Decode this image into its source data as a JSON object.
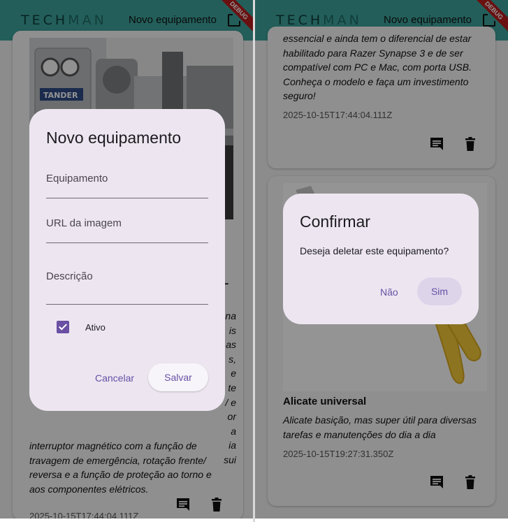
{
  "app": {
    "logo_part1": "TECH",
    "logo_part2": "MAN",
    "title": "Novo equipamento",
    "debug_banner": "DEBUG",
    "add_icon": "add-box-icon"
  },
  "left_screen": {
    "card": {
      "image_brand": "TANDER",
      "title_fragment": "L",
      "desc_right_fragments": [
        "na",
        "is",
        "as",
        "s,",
        "e",
        "te",
        "/ e",
        "or",
        "a",
        "ia",
        "sui"
      ],
      "desc_visible_lines": [
        "interruptor magnético com a função de",
        "travagem de emergência, rotação frente/",
        "reversa e a função de proteção ao torno e",
        "aos componentes elétricos."
      ],
      "date": "2025-10-15T17:44:04.111Z",
      "comment_icon": "comment-icon",
      "delete_icon": "delete-icon"
    },
    "dialog": {
      "title": "Novo equipamento",
      "field_equipment": "Equipamento",
      "field_image_url": "URL da imagem",
      "field_description": "Descrição",
      "checkbox_label": "Ativo",
      "checkbox_checked": true,
      "cancel_label": "Cancelar",
      "save_label": "Salvar"
    }
  },
  "right_screen": {
    "card1": {
      "desc_lines": [
        "essencial e ainda tem o diferencial de estar",
        "habilitado para Razer Synapse 3 e de ser",
        "compatível com PC e Mac, com porta USB.",
        "Conheça o modelo e faça um investimento",
        "seguro!"
      ],
      "date": "2025-10-15T17:44:04.111Z"
    },
    "card2": {
      "title": "Alicate universal",
      "desc_lines": [
        "Alicate basição, mas super útil para diversas",
        "tarefas e manutenções do dia a dia"
      ],
      "date": "2025-10-15T19:27:31.350Z"
    },
    "dialog": {
      "title": "Confirmar",
      "message": "Deseja deletar este equipamento?",
      "no_label": "Não",
      "yes_label": "Sim"
    }
  },
  "colors": {
    "appbar": "#3da39b",
    "dialog_bg": "#ede6f1",
    "accent": "#6750a4",
    "checkbox": "#6a4fa3",
    "debug": "#b71c1c"
  }
}
